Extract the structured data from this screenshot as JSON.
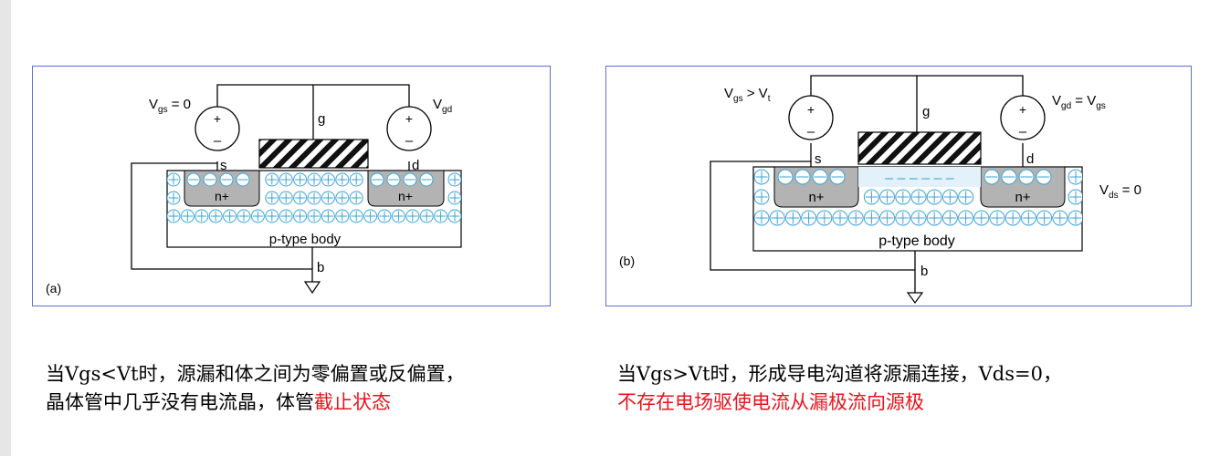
{
  "panel_a": {
    "tag": "(a)",
    "vgs_label": {
      "v": "V",
      "sub": "gs",
      "rest": " = 0"
    },
    "vgd_label": {
      "v": "V",
      "sub": "gd"
    },
    "plus": "+",
    "minus": "–",
    "gate": "g",
    "source": "s",
    "drain": "d",
    "body": "b",
    "n_region": "n+",
    "body_label": "p-type body"
  },
  "panel_b": {
    "tag": "(b)",
    "vgs_label": {
      "v": "V",
      "sub": "gs",
      "mid": " > V",
      "sub2": "t"
    },
    "vgd_label": {
      "v": "V",
      "sub": "gd",
      "mid": " = V",
      "sub2": "gs"
    },
    "vds_label": {
      "v": "V",
      "sub": "ds",
      "rest": " = 0"
    },
    "plus": "+",
    "minus": "–",
    "gate": "g",
    "source": "s",
    "drain": "d",
    "body": "b",
    "n_region": "n+",
    "channel": "– – – – – –",
    "body_label": "p-type body"
  },
  "caption_a": {
    "line1_pre": "当",
    "line1_code": "Vgs<Vt",
    "line1_post": "时，源漏和体之间为零偏置或反偏置，",
    "line2_black": "晶体管中几乎没有电流晶，体管",
    "line2_red": "截止状态"
  },
  "caption_b": {
    "line1_pre": "当",
    "line1_code": "Vgs>Vt",
    "line1_mid": "时，形成导电沟道将源漏连接，",
    "line1_code2": "Vds=0",
    "line1_post": "，",
    "line2_red": "不存在电场驱使电流从漏极流向源极"
  },
  "colors": {
    "border": "#5b6fd0",
    "ion": "#3aa3d8",
    "n_region": "#b3b3b3",
    "caption_red": "#e8141d"
  }
}
